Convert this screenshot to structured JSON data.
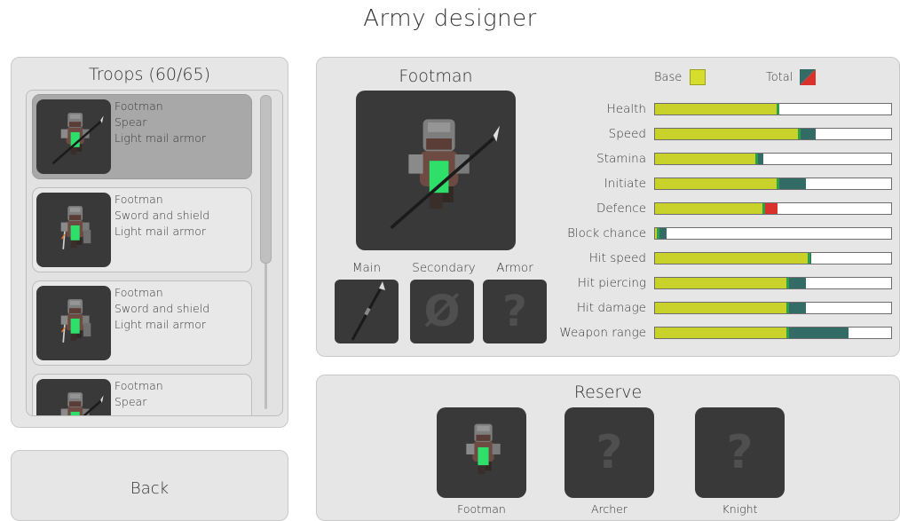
{
  "page": {
    "title": "Army designer"
  },
  "troops": {
    "title": "Troops (60/65)",
    "items": [
      {
        "line1": "Footman",
        "line2": "Spear",
        "line3": "Light mail armor",
        "selected": true,
        "icon": "footman-spear-icon"
      },
      {
        "line1": "Footman",
        "line2": "Sword and shield",
        "line3": "Light mail armor",
        "selected": false,
        "icon": "footman-sword-shield-icon"
      },
      {
        "line1": "Footman",
        "line2": "Sword and shield",
        "line3": "Light mail armor",
        "selected": false,
        "icon": "footman-sword-shield-icon"
      },
      {
        "line1": "Footman",
        "line2": "Spear",
        "line3": "",
        "selected": false,
        "icon": "footman-spear-icon"
      }
    ]
  },
  "back": {
    "label": "Back"
  },
  "details": {
    "unit_name": "Footman",
    "slots": {
      "main_label": "Main",
      "secondary_label": "Secondary",
      "armor_label": "Armor",
      "main_icon": "spear-icon",
      "secondary_icon": "empty-slot-icon",
      "secondary_glyph": "Ø",
      "armor_icon": "unknown-icon",
      "armor_glyph": "?"
    },
    "legend": {
      "base_label": "Base",
      "total_label": "Total"
    },
    "colors": {
      "base": "#c9d12b",
      "bonus": "#336b66",
      "penalty": "#d9312b",
      "marker": "#2aa14a"
    },
    "stats": [
      {
        "label": "Health",
        "base": 0.52,
        "total": 0.52
      },
      {
        "label": "Speed",
        "base": 0.61,
        "total": 0.68
      },
      {
        "label": "Stamina",
        "base": 0.43,
        "total": 0.46
      },
      {
        "label": "Initiate",
        "base": 0.52,
        "total": 0.64
      },
      {
        "label": "Defence",
        "base": 0.52,
        "total": 0.46
      },
      {
        "label": "Block chance",
        "base": 0.01,
        "total": 0.05
      },
      {
        "label": "Hit speed",
        "base": 0.65,
        "total": 0.66
      },
      {
        "label": "Hit piercing",
        "base": 0.56,
        "total": 0.64
      },
      {
        "label": "Hit damage",
        "base": 0.56,
        "total": 0.64
      },
      {
        "label": "Weapon range",
        "base": 0.56,
        "total": 0.82
      }
    ]
  },
  "reserve": {
    "title": "Reserve",
    "items": [
      {
        "label": "Footman",
        "icon": "footman-icon",
        "glyph": ""
      },
      {
        "label": "Archer",
        "icon": "unknown-icon",
        "glyph": "?"
      },
      {
        "label": "Knight",
        "icon": "unknown-icon",
        "glyph": "?"
      }
    ]
  }
}
